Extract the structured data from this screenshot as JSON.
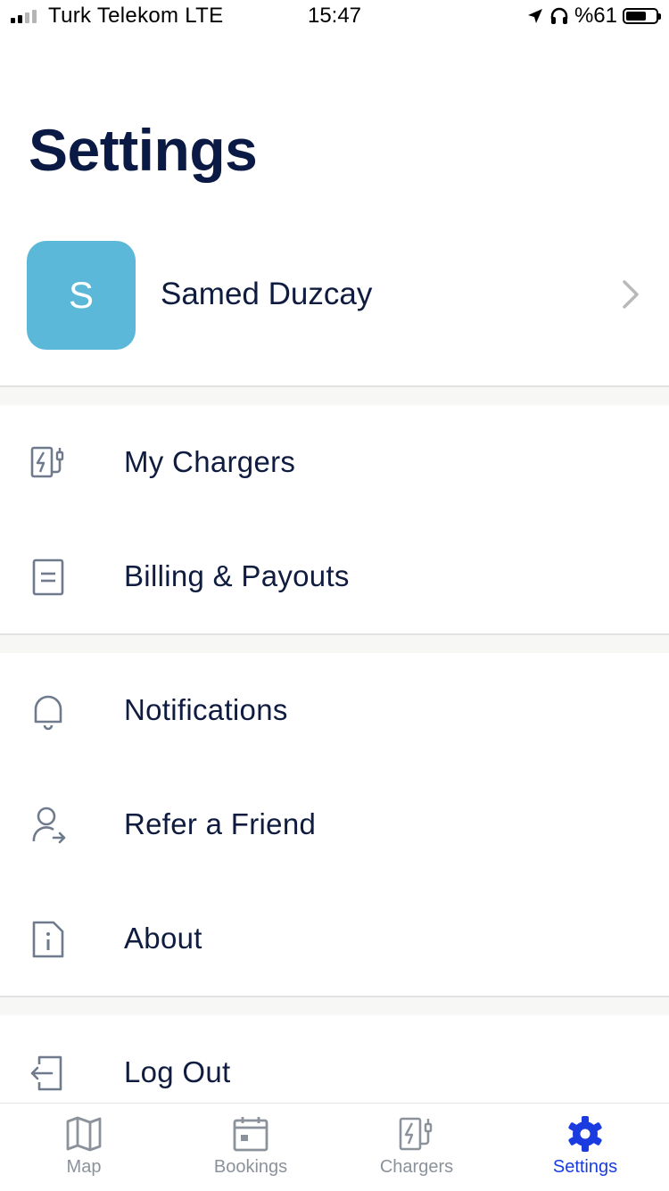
{
  "status_bar": {
    "carrier": "Turk Telekom  LTE",
    "time": "15:47",
    "battery": "%61"
  },
  "title": "Settings",
  "profile": {
    "initial": "S",
    "name": "Samed Duzcay"
  },
  "menu": {
    "my_chargers": "My Chargers",
    "billing": "Billing & Payouts",
    "notifications": "Notifications",
    "refer": "Refer a Friend",
    "about": "About",
    "logout": "Log Out"
  },
  "tabs": {
    "map": "Map",
    "bookings": "Bookings",
    "chargers": "Chargers",
    "settings": "Settings"
  },
  "colors": {
    "accent": "#1a3be0",
    "avatar": "#5bb8d8",
    "text": "#0f1c3f",
    "icon": "#6f7b8c"
  }
}
